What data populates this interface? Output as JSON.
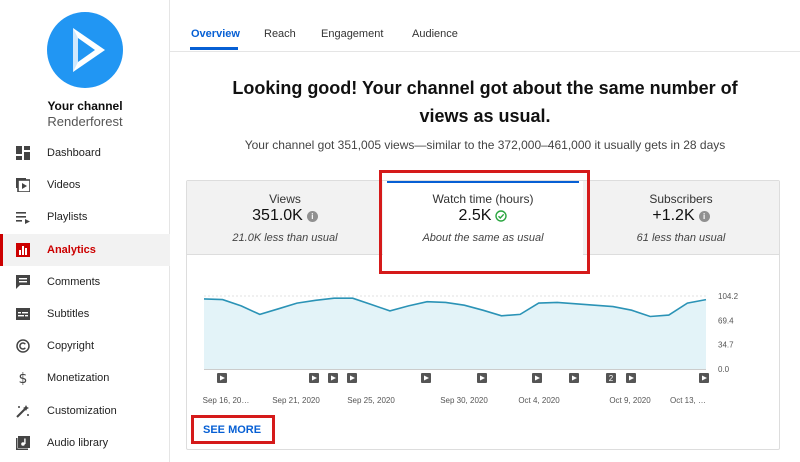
{
  "sidebar": {
    "channel_label": "Your channel",
    "channel_name": "Renderforest",
    "items": [
      {
        "label": "Dashboard",
        "icon": "dashboard-icon"
      },
      {
        "label": "Videos",
        "icon": "videos-icon"
      },
      {
        "label": "Playlists",
        "icon": "playlists-icon"
      },
      {
        "label": "Analytics",
        "icon": "analytics-icon",
        "active": true
      },
      {
        "label": "Comments",
        "icon": "comments-icon"
      },
      {
        "label": "Subtitles",
        "icon": "subtitles-icon"
      },
      {
        "label": "Copyright",
        "icon": "copyright-icon"
      },
      {
        "label": "Monetization",
        "icon": "monetization-icon"
      },
      {
        "label": "Customization",
        "icon": "customization-icon"
      },
      {
        "label": "Audio library",
        "icon": "audio-library-icon"
      }
    ],
    "accent": "#cc0000"
  },
  "tabs": [
    {
      "label": "Overview",
      "active": true
    },
    {
      "label": "Reach"
    },
    {
      "label": "Engagement"
    },
    {
      "label": "Audience"
    }
  ],
  "main": {
    "headline": "Looking good! Your channel got about the same number of views as usual.",
    "subline": "Your channel got 351,005 views—similar to the 372,000–461,000 it usually gets in 28 days",
    "see_more": "SEE MORE"
  },
  "metrics": [
    {
      "label": "Views",
      "value": "351.0K",
      "note": "21.0K less than usual",
      "status_icon": "info-icon"
    },
    {
      "label": "Watch time (hours)",
      "value": "2.5K",
      "note": "About the same as usual",
      "status_icon": "check-circle-icon",
      "selected": true
    },
    {
      "label": "Subscribers",
      "value": "+1.2K",
      "note": "61 less than usual",
      "status_icon": "info-icon"
    }
  ],
  "colors": {
    "link": "#065fd4",
    "highlight": "#d51a1a",
    "line": "#2b93b6",
    "fill": "#e3f3f8",
    "check": "#2ba640"
  },
  "chart_data": {
    "type": "area",
    "y_ticks": [
      "104.2",
      "69.4",
      "34.7",
      "0.0"
    ],
    "ylim": [
      0,
      104.2
    ],
    "x_tick_labels": [
      "Sep 16, 20…",
      "Sep 21, 2020",
      "Sep 25, 2020",
      "Sep 30, 2020",
      "Oct 4, 2020",
      "Oct 9, 2020",
      "Oct 13, …"
    ],
    "series": [
      {
        "values": [
          100,
          99,
          90,
          78,
          86,
          94,
          98,
          101,
          101,
          92,
          83,
          90,
          96,
          95,
          91,
          84,
          76,
          78,
          94,
          95,
          93,
          91,
          89,
          84,
          75,
          77,
          94,
          99
        ]
      }
    ],
    "video_markers": [
      "",
      "",
      "",
      "",
      "",
      "",
      "",
      "",
      "",
      "",
      "",
      "2",
      "",
      ""
    ],
    "grid": true
  }
}
